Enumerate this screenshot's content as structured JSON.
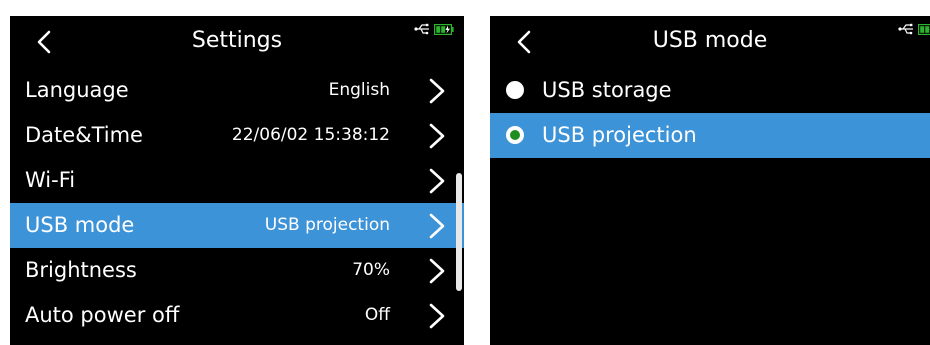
{
  "settings_screen": {
    "title": "Settings",
    "rows": [
      {
        "label": "Language",
        "value": "English"
      },
      {
        "label": "Date&Time",
        "value": "22/06/02 15:38:12"
      },
      {
        "label": "Wi-Fi",
        "value": ""
      },
      {
        "label": "USB mode",
        "value": "USB projection"
      },
      {
        "label": "Brightness",
        "value": "70%"
      },
      {
        "label": "Auto power off",
        "value": "Off"
      }
    ],
    "selected_row": "USB mode"
  },
  "usb_mode_screen": {
    "title": "USB mode",
    "options": [
      {
        "label": "USB storage",
        "checked": false
      },
      {
        "label": "USB projection",
        "checked": true
      }
    ]
  },
  "icons": {
    "back": "back-chevron-icon",
    "usb": "usb-icon",
    "battery": "battery-charging-icon",
    "row_arrow": "chevron-right-icon"
  },
  "colors": {
    "selected_row": "#3d93d8",
    "radio_checked": "#1f8d1f",
    "battery": "#2db32d"
  }
}
